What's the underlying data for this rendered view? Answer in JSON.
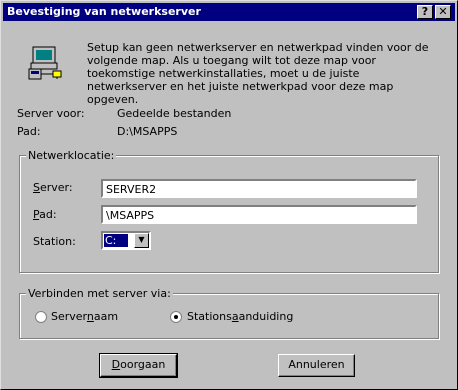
{
  "window": {
    "title": "Bevestiging van netwerkserver",
    "help_glyph": "?",
    "close_glyph": "✕"
  },
  "message": "Setup kan geen netwerkserver en netwerkpad vinden voor de volgende map. Als u toegang wilt tot deze map voor toekomstige netwerkinstallaties, moet u de juiste netwerkserver en het juiste netwerkpad voor deze map opgeven.",
  "info": {
    "server_label": "Server voor:",
    "server_value": "Gedeelde bestanden",
    "path_label": "Pad:",
    "path_value": "D:\\MSAPPS"
  },
  "location": {
    "title": "Netwerklocatie:",
    "server_label_access": "S",
    "server_label_rest": "erver:",
    "server_value": "SERVER2",
    "path_label_access": "P",
    "path_label_rest": "ad:",
    "path_value": "\\MSAPPS",
    "station_label": "Station:",
    "station_value": "C:"
  },
  "connect": {
    "title": "Verbinden met server via:",
    "option1_pre": "Server",
    "option1_access": "n",
    "option1_post": "aam",
    "option2_pre": "Stations",
    "option2_access": "a",
    "option2_post": "anduiding",
    "selected": "Stationsaanduiding"
  },
  "buttons": {
    "continue_access": "D",
    "continue_rest": "oorgaan",
    "cancel": "Annuleren"
  }
}
